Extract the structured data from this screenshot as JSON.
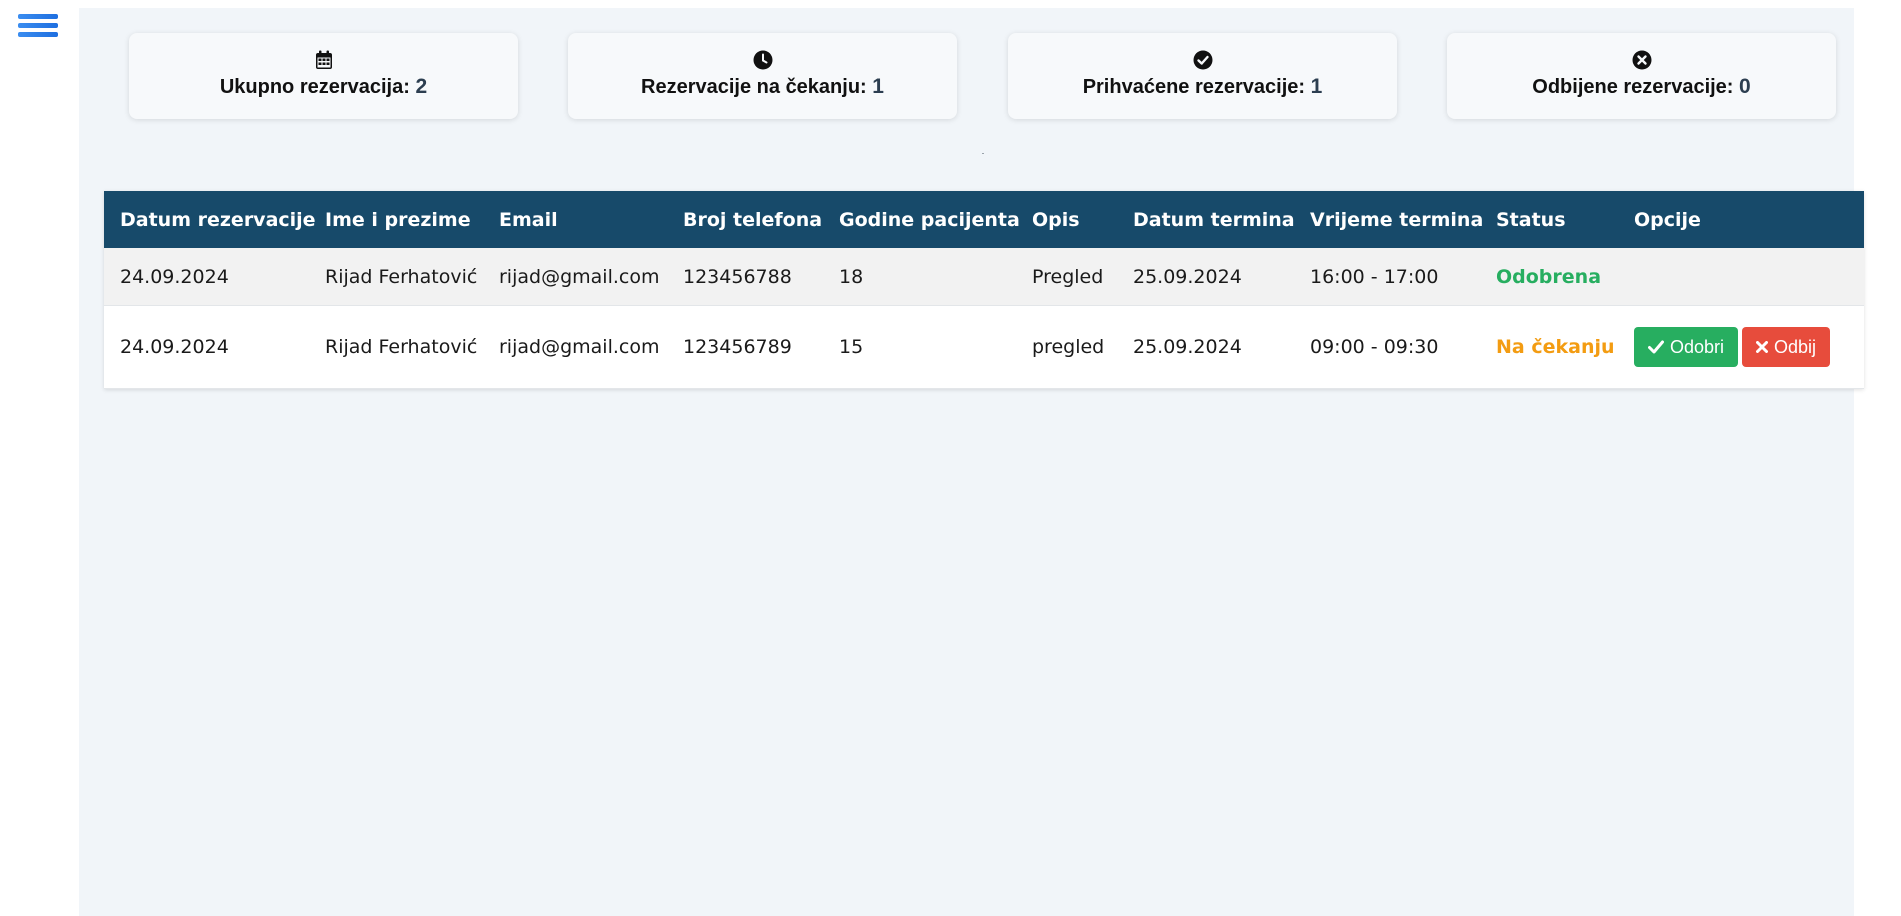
{
  "stats": [
    {
      "label": "Ukupno rezervacija:",
      "value": "2",
      "icon": "calendar-icon"
    },
    {
      "label": "Rezervacije na čekanju:",
      "value": "1",
      "icon": "clock-icon"
    },
    {
      "label": "Prihvaćene rezervacije:",
      "value": "1",
      "icon": "check-circle-icon"
    },
    {
      "label": "Odbijene rezervacije:",
      "value": "0",
      "icon": "x-circle-icon"
    }
  ],
  "table": {
    "headers": [
      "Datum rezervacije",
      "Ime i prezime",
      "Email",
      "Broj telefona",
      "Godine pacijenta",
      "Opis",
      "Datum termina",
      "Vrijeme termina",
      "Status",
      "Opcije"
    ],
    "rows": [
      {
        "date": "24.09.2024",
        "name": "Rijad Ferhatović",
        "email": "rijad@gmail.com",
        "phone": "123456788",
        "age": "18",
        "description": "Pregled",
        "appointment_date": "25.09.2024",
        "appointment_time": "16:00 - 17:00",
        "status": "Odobrena"
      },
      {
        "date": "24.09.2024",
        "name": "Rijad Ferhatović",
        "email": "rijad@gmail.com",
        "phone": "123456789",
        "age": "15",
        "description": "pregled",
        "appointment_date": "25.09.2024",
        "appointment_time": "09:00 - 09:30",
        "status": "Na čekanju"
      }
    ]
  },
  "actions": {
    "approve_label": "Odobri",
    "reject_label": "Odbij"
  },
  "colors": {
    "header_bg": "#174a6a",
    "approved": "#27ae60",
    "pending": "#f39c12",
    "reject": "#e74c3c",
    "menu_icon": "#2f80ed"
  }
}
